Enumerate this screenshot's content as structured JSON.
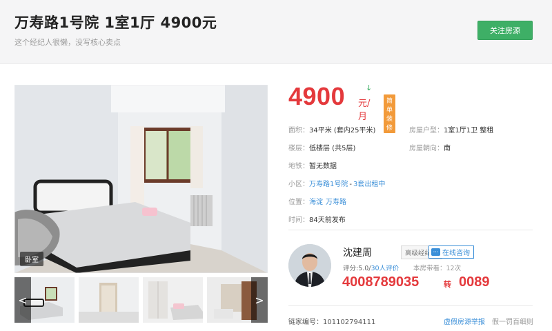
{
  "header": {
    "title": "万寿路1号院 1室1厅 4900元",
    "subtitle": "这个经纪人很懒，没写核心卖点",
    "follow_label": "关注房源"
  },
  "gallery": {
    "room_label": "卧室",
    "prev_label": "<",
    "next_label": ">"
  },
  "price": {
    "amount": "4900",
    "unit": "元/月",
    "trend_icon": "↓",
    "decoration_tag": "简单装修"
  },
  "info": {
    "area_label": "面积：",
    "area_value": "34平米 (套内25平米)",
    "layout_label": "房屋户型：",
    "layout_value": "1室1厅1卫 整租",
    "floor_label": "楼层：",
    "floor_value": "低楼层 (共5层)",
    "orientation_label": "房屋朝向：",
    "orientation_value": "南",
    "subway_label": "地铁：",
    "subway_value": "暂无数据",
    "community_label": "小区：",
    "community_name": "万寿路1号院",
    "community_dash": "-",
    "community_rentals": "3套出租中",
    "location_label": "位置：",
    "district": "海淀",
    "area_name": "万寿路",
    "time_label": "时间：",
    "time_value": "84天前发布"
  },
  "agent": {
    "name": "沈建周",
    "title_tag": "高级经纪人",
    "consult_label": "在线咨询",
    "rating_prefix": "评分:5.0/",
    "rating_link": "30人评价",
    "visits": "本房带看：12次",
    "phone": "4008789035",
    "phone_sep": "转",
    "phone_ext": "0089"
  },
  "footer": {
    "listing_id": "链家编号：101102794111",
    "report_label": "虚假房源举报",
    "compensate_label": "假一罚百细则"
  },
  "colors": {
    "price_red": "#e4393c",
    "follow_green": "#3eaf66",
    "link_blue": "#3b8fd8",
    "decoration_orange": "#f29a3a"
  }
}
